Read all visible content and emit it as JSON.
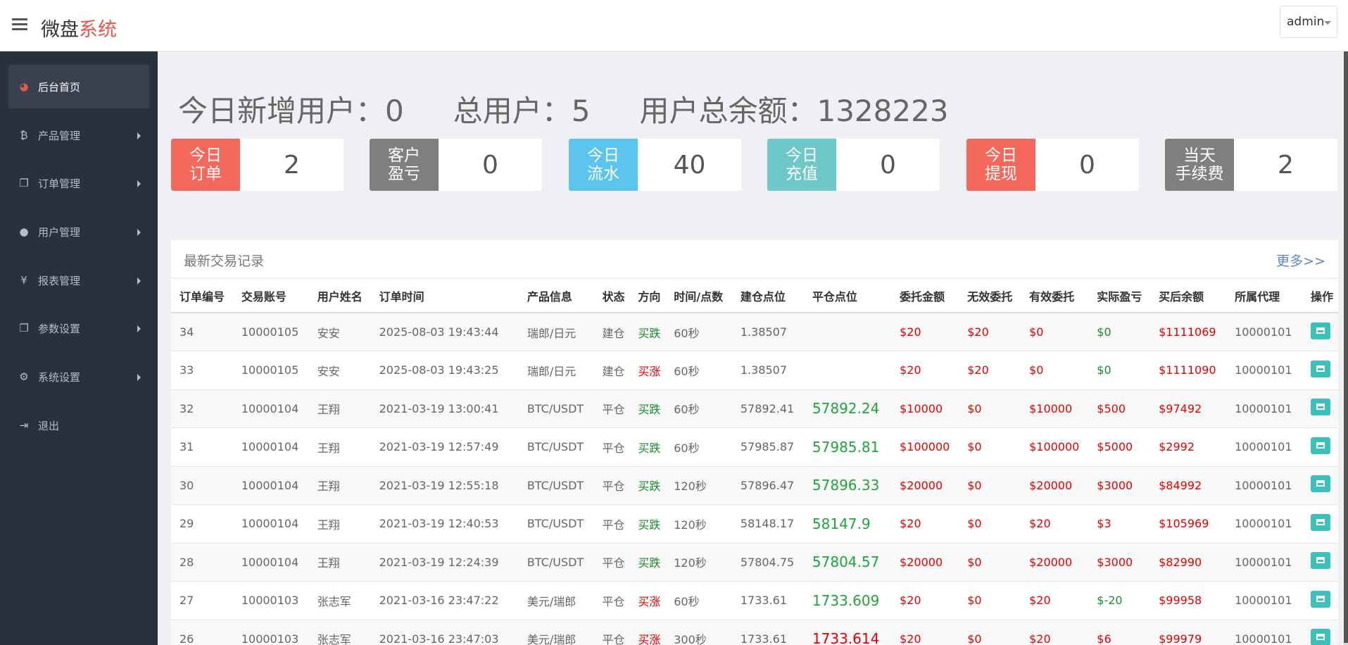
{
  "header": {
    "brand_main": "微盘",
    "brand_accent": "系统",
    "user": "admin"
  },
  "sidebar": {
    "items": [
      {
        "label": "后台首页",
        "icon": "dashboard-icon"
      },
      {
        "label": "产品管理",
        "icon": "bitcoin-icon"
      },
      {
        "label": "订单管理",
        "icon": "copy-icon"
      },
      {
        "label": "用户管理",
        "icon": "user-icon"
      },
      {
        "label": "报表管理",
        "icon": "yen-icon"
      },
      {
        "label": "参数设置",
        "icon": "copy-icon"
      },
      {
        "label": "系统设置",
        "icon": "gears-icon"
      },
      {
        "label": "退出",
        "icon": "logout-icon"
      }
    ]
  },
  "summary": {
    "new_users": "今日新增用户：0",
    "total_users": "总用户：5",
    "total_balance": "用户总余额：1328223"
  },
  "cards": [
    {
      "line1": "今日",
      "line2": "订单",
      "value": "2",
      "color": "#f4695b"
    },
    {
      "line1": "客户",
      "line2": "盈亏",
      "value": "0",
      "color": "#7f7f7f"
    },
    {
      "line1": "今日",
      "line2": "流水",
      "value": "40",
      "color": "#5bc5ee"
    },
    {
      "line1": "今日",
      "line2": "充值",
      "value": "0",
      "color": "#6dc9c9"
    },
    {
      "line1": "今日",
      "line2": "提现",
      "value": "0",
      "color": "#f4695b"
    },
    {
      "line1": "当天",
      "line2": "手续费",
      "value": "2",
      "color": "#7f7f7f"
    }
  ],
  "panel": {
    "title": "最新交易记录",
    "more": "更多>>"
  },
  "table": {
    "headers": [
      "订单编号",
      "交易账号",
      "用户姓名",
      "订单时间",
      "产品信息",
      "状态",
      "方向",
      "时间/点数",
      "建仓点位",
      "平仓点位",
      "委托金额",
      "无效委托",
      "有效委托",
      "实际盈亏",
      "买后余额",
      "所属代理",
      "操作"
    ],
    "rows": [
      [
        "34",
        "10000105",
        "安安",
        "2025-08-03 19:43:44",
        "瑞郎/日元",
        "建仓",
        "买跌",
        "60秒",
        "1.38507",
        "",
        "$20",
        "$20",
        "$0",
        "$0",
        "$1111069",
        "10000101"
      ],
      [
        "33",
        "10000105",
        "安安",
        "2025-08-03 19:43:25",
        "瑞郎/日元",
        "建仓",
        "买涨",
        "60秒",
        "1.38507",
        "",
        "$20",
        "$20",
        "$0",
        "$0",
        "$1111090",
        "10000101"
      ],
      [
        "32",
        "10000104",
        "王翔",
        "2021-03-19 13:00:41",
        "BTC/USDT",
        "平仓",
        "买跌",
        "60秒",
        "57892.41",
        "57892.24",
        "$10000",
        "$0",
        "$10000",
        "$500",
        "$97492",
        "10000101"
      ],
      [
        "31",
        "10000104",
        "王翔",
        "2021-03-19 12:57:49",
        "BTC/USDT",
        "平仓",
        "买跌",
        "60秒",
        "57985.87",
        "57985.81",
        "$100000",
        "$0",
        "$100000",
        "$5000",
        "$2992",
        "10000101"
      ],
      [
        "30",
        "10000104",
        "王翔",
        "2021-03-19 12:55:18",
        "BTC/USDT",
        "平仓",
        "买跌",
        "120秒",
        "57896.47",
        "57896.33",
        "$20000",
        "$0",
        "$20000",
        "$3000",
        "$84992",
        "10000101"
      ],
      [
        "29",
        "10000104",
        "王翔",
        "2021-03-19 12:40:53",
        "BTC/USDT",
        "平仓",
        "买跌",
        "120秒",
        "58148.17",
        "58147.9",
        "$20",
        "$0",
        "$20",
        "$3",
        "$105969",
        "10000101"
      ],
      [
        "28",
        "10000104",
        "王翔",
        "2021-03-19 12:24:39",
        "BTC/USDT",
        "平仓",
        "买跌",
        "120秒",
        "57804.75",
        "57804.57",
        "$20000",
        "$0",
        "$20000",
        "$3000",
        "$82990",
        "10000101"
      ],
      [
        "27",
        "10000103",
        "张志军",
        "2021-03-16 23:47:22",
        "美元/瑞郎",
        "平仓",
        "买涨",
        "60秒",
        "1733.61",
        "1733.609",
        "$20",
        "$0",
        "$20",
        "$-20",
        "$99958",
        "10000101"
      ],
      [
        "26",
        "10000103",
        "张志军",
        "2021-03-16 23:47:03",
        "美元/瑞郎",
        "平仓",
        "买涨",
        "300秒",
        "1733.61",
        "1733.614",
        "$20",
        "$0",
        "$20",
        "$6",
        "$99979",
        "10000101"
      ]
    ]
  },
  "colors": {
    "up": "#e40000",
    "down": "#1a8c2c",
    "sidebar_bg": "#2a313c",
    "accent": "#e8574c"
  }
}
